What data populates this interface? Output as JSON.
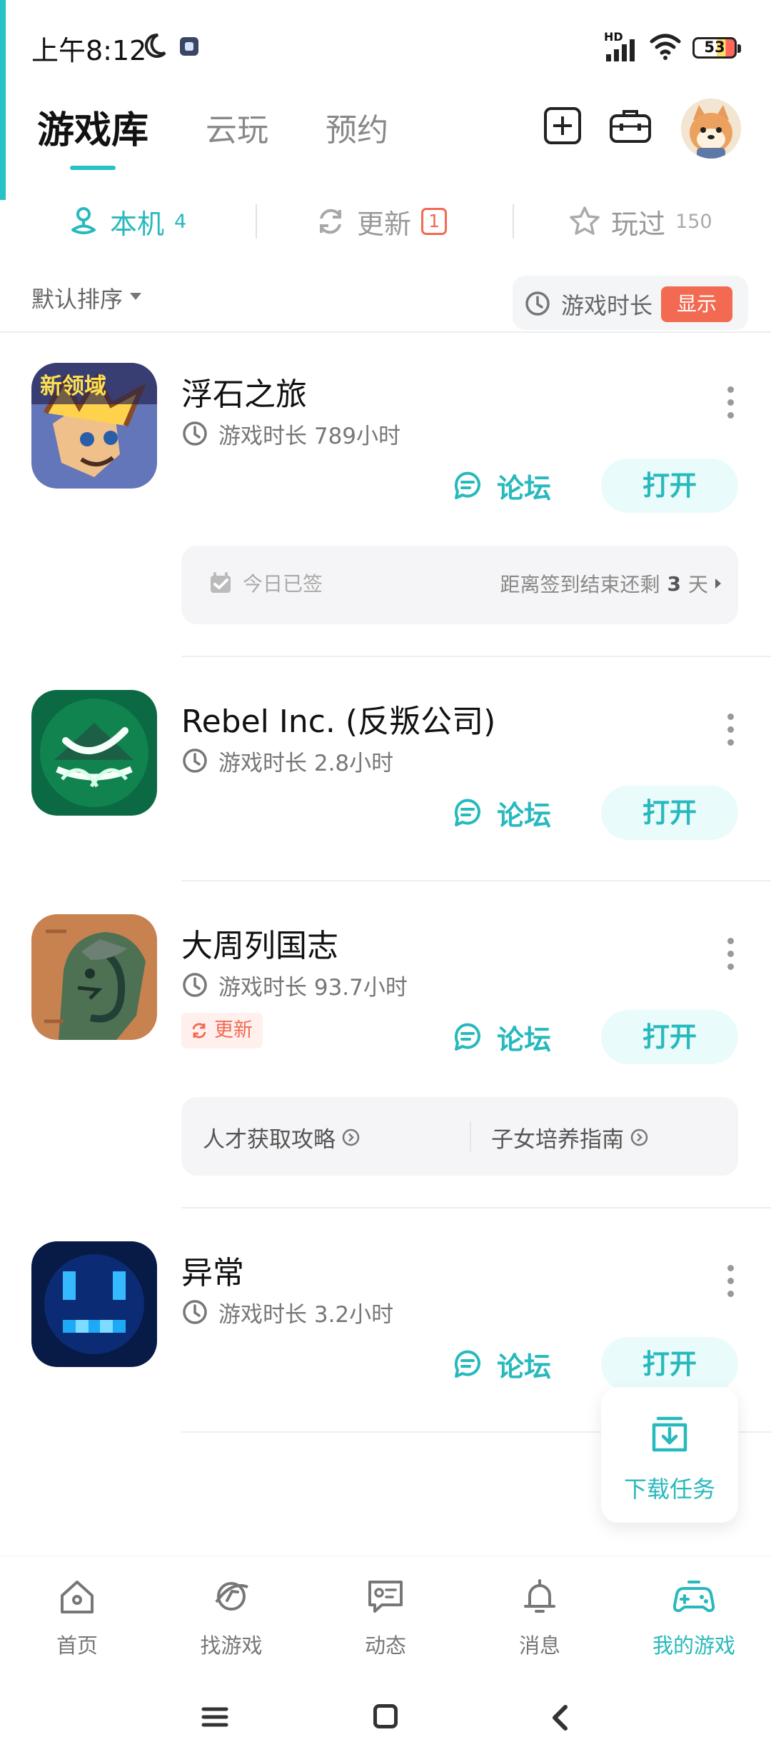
{
  "status_bar": {
    "time": "上午8:12",
    "network": "HD",
    "battery": "53"
  },
  "header": {
    "tabs": [
      {
        "label": "游戏库",
        "active": true
      },
      {
        "label": "云玩",
        "active": false
      },
      {
        "label": "预约",
        "active": false
      }
    ]
  },
  "sub_tabs": {
    "items": [
      {
        "label": "本机",
        "count": "4",
        "active": true
      },
      {
        "label": "更新",
        "count": "1",
        "active": false
      },
      {
        "label": "玩过",
        "count": "150",
        "active": false
      }
    ]
  },
  "sort": {
    "label": "默认排序",
    "playtime_label": "游戏时长",
    "show_label": "显示"
  },
  "games": [
    {
      "title": "浮石之旅",
      "playtime": "游戏时长 789小时",
      "forum_label": "论坛",
      "open_label": "打开",
      "checkin_label": "今日已签",
      "checkin_remaining_prefix": "距离签到结束还剩",
      "checkin_remaining_value": "3",
      "checkin_remaining_unit": "天"
    },
    {
      "title": "Rebel Inc. (反叛公司)",
      "playtime": "游戏时长 2.8小时",
      "forum_label": "论坛",
      "open_label": "打开"
    },
    {
      "title": "大周列国志",
      "playtime": "游戏时长 93.7小时",
      "update_label": "更新",
      "forum_label": "论坛",
      "open_label": "打开",
      "guides": [
        "人才获取攻略",
        "子女培养指南"
      ]
    },
    {
      "title": "异常",
      "playtime": "游戏时长 3.2小时",
      "forum_label": "论坛",
      "open_label": "打开"
    }
  ],
  "download_task": {
    "label": "下载任务"
  },
  "bottom_nav": {
    "items": [
      {
        "label": "首页",
        "icon": "home-icon"
      },
      {
        "label": "找游戏",
        "icon": "find-game-icon"
      },
      {
        "label": "动态",
        "icon": "feed-icon"
      },
      {
        "label": "消息",
        "icon": "bell-icon"
      },
      {
        "label": "我的游戏",
        "icon": "gamepad-icon",
        "active": true
      }
    ]
  },
  "colors": {
    "accent": "#27b9bd",
    "warning": "#f26a51"
  }
}
